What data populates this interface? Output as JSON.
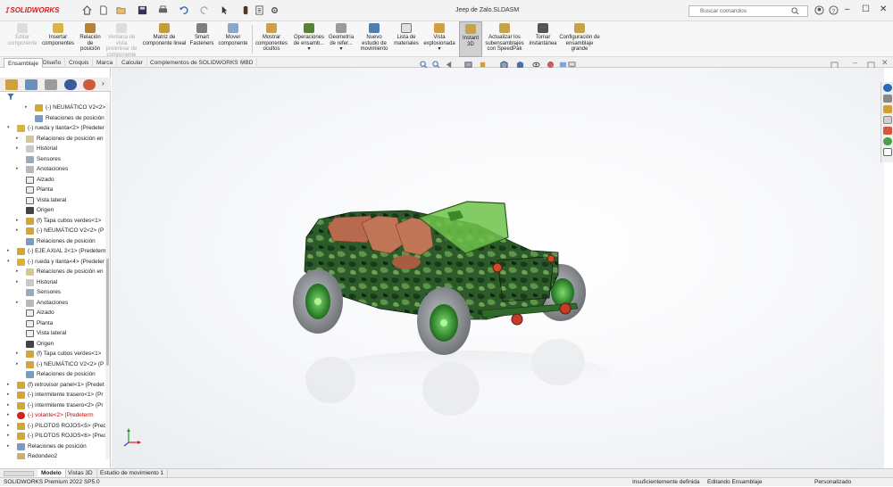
{
  "app": {
    "logo": "SOLIDWORKS",
    "document_title": "Jeep de Zalo.SLDASM"
  },
  "search": {
    "placeholder": "Buscar comandos"
  },
  "ribbon": {
    "items": [
      {
        "label": "Editar componente",
        "disabled": true
      },
      {
        "label": "Insertar componentes",
        "disabled": false
      },
      {
        "label": "Relación de posición",
        "disabled": false
      },
      {
        "label": "Ventana de vista preliminar de componente",
        "disabled": true
      },
      {
        "label": "Matriz de componente lineal",
        "disabled": false
      },
      {
        "label": "Smart Fasteners",
        "disabled": false
      },
      {
        "label": "Mover componente",
        "disabled": false
      },
      {
        "label": "Mostrar componentes ocultos",
        "disabled": false
      },
      {
        "label": "Operaciones de ensamb...",
        "disabled": false
      },
      {
        "label": "Geometría de refer...",
        "disabled": false
      },
      {
        "label": "Nuevo estudio de movimiento",
        "disabled": false
      },
      {
        "label": "Lista de materiales",
        "disabled": false
      },
      {
        "label": "Vista explosionada",
        "disabled": false
      },
      {
        "label": "Instant 3D",
        "disabled": false,
        "active": true
      },
      {
        "label": "Actualizar los subensamblajes con SpeedPak",
        "disabled": false
      },
      {
        "label": "Tomar instantánea",
        "disabled": false
      },
      {
        "label": "Configuración de ensamblaje grande",
        "disabled": false
      }
    ]
  },
  "command_tabs": [
    "Ensamblaje",
    "Diseño",
    "Croquis",
    "Marca",
    "Calcular",
    "Complementos de SOLIDWORKS",
    "MBD"
  ],
  "tree": [
    {
      "level": 2,
      "arrow": "▸",
      "icon": "part",
      "text": "(-) NEUMÁTICO V2<2> (P"
    },
    {
      "level": 2,
      "arrow": "",
      "icon": "mates",
      "text": "Relaciones de posición"
    },
    {
      "level": 0,
      "arrow": "▾",
      "icon": "assembly",
      "text": "(-) rueda y llanta<2> (Predeter"
    },
    {
      "level": 1,
      "arrow": "▸",
      "icon": "mates-folder",
      "text": "Relaciones de posición en"
    },
    {
      "level": 1,
      "arrow": "▸",
      "icon": "history",
      "text": "Historial"
    },
    {
      "level": 1,
      "arrow": "",
      "icon": "sensor",
      "text": "Sensores"
    },
    {
      "level": 1,
      "arrow": "▸",
      "icon": "annotation",
      "text": "Anotaciones"
    },
    {
      "level": 1,
      "arrow": "",
      "icon": "plane",
      "text": "Alzado"
    },
    {
      "level": 1,
      "arrow": "",
      "icon": "plane",
      "text": "Planta"
    },
    {
      "level": 1,
      "arrow": "",
      "icon": "plane",
      "text": "Vista lateral"
    },
    {
      "level": 1,
      "arrow": "",
      "icon": "origin",
      "text": "Origen"
    },
    {
      "level": 1,
      "arrow": "▸",
      "icon": "part",
      "text": "(f) Tapa cubos verdes<1>"
    },
    {
      "level": 1,
      "arrow": "▸",
      "icon": "part",
      "text": "(-) NEUMÁTICO V2<2> (P"
    },
    {
      "level": 1,
      "arrow": "",
      "icon": "mates",
      "text": "Relaciones de posición"
    },
    {
      "level": 0,
      "arrow": "▸",
      "icon": "part",
      "text": "(-) EJE AXIAL 2<1> (Predeterm"
    },
    {
      "level": 0,
      "arrow": "▾",
      "icon": "assembly",
      "text": "(-) rueda y llanta<4> (Predeter"
    },
    {
      "level": 1,
      "arrow": "▸",
      "icon": "mates-folder",
      "text": "Relaciones de posición en"
    },
    {
      "level": 1,
      "arrow": "▸",
      "icon": "history",
      "text": "Historial"
    },
    {
      "level": 1,
      "arrow": "",
      "icon": "sensor",
      "text": "Sensores"
    },
    {
      "level": 1,
      "arrow": "▸",
      "icon": "annotation",
      "text": "Anotaciones"
    },
    {
      "level": 1,
      "arrow": "",
      "icon": "plane",
      "text": "Alzado"
    },
    {
      "level": 1,
      "arrow": "",
      "icon": "plane",
      "text": "Planta"
    },
    {
      "level": 1,
      "arrow": "",
      "icon": "plane",
      "text": "Vista lateral"
    },
    {
      "level": 1,
      "arrow": "",
      "icon": "origin",
      "text": "Origen"
    },
    {
      "level": 1,
      "arrow": "▸",
      "icon": "part",
      "text": "(f) Tapa cubos verdes<1>"
    },
    {
      "level": 1,
      "arrow": "▸",
      "icon": "part",
      "text": "(-) NEUMÁTICO V2<2> (P"
    },
    {
      "level": 1,
      "arrow": "",
      "icon": "mates",
      "text": "Relaciones de posición"
    },
    {
      "level": 0,
      "arrow": "▸",
      "icon": "part",
      "text": "(f) retrovisor panel<1> (Predet"
    },
    {
      "level": 0,
      "arrow": "▸",
      "icon": "part",
      "text": "(-) intermitente trasero<1> (Pr"
    },
    {
      "level": 0,
      "arrow": "▸",
      "icon": "part",
      "text": "(-) intermitente trasero<2> (Pr"
    },
    {
      "level": 0,
      "arrow": "▸",
      "icon": "error",
      "text": "(-) volante<2> (Predeterm",
      "error": true
    },
    {
      "level": 0,
      "arrow": "▸",
      "icon": "part",
      "text": "(-) PILOTOS ROJOS<5> (Prede"
    },
    {
      "level": 0,
      "arrow": "▸",
      "icon": "part",
      "text": "(-) PILOTOS ROJOS<6> (Prede"
    },
    {
      "level": 0,
      "arrow": "▸",
      "icon": "mates",
      "text": "Relaciones de posición"
    },
    {
      "level": 0,
      "arrow": "",
      "icon": "folder",
      "text": "Redondeo2"
    }
  ],
  "bottom_tabs": [
    "Modelo",
    "Vistas 3D",
    "Estudio de movimiento 1"
  ],
  "status": {
    "product": "SOLIDWORKS Premium 2022 SP5.0",
    "definition": "Insuficientemente definida",
    "mode": "Editando Ensamblaje",
    "custom": "Personalizado"
  },
  "colors": {
    "accent": "#d02020",
    "camo_dark": "#1f4a22",
    "camo_light": "#4f8a3c",
    "seat": "#b86a4e",
    "glass": "#6fc24a"
  }
}
